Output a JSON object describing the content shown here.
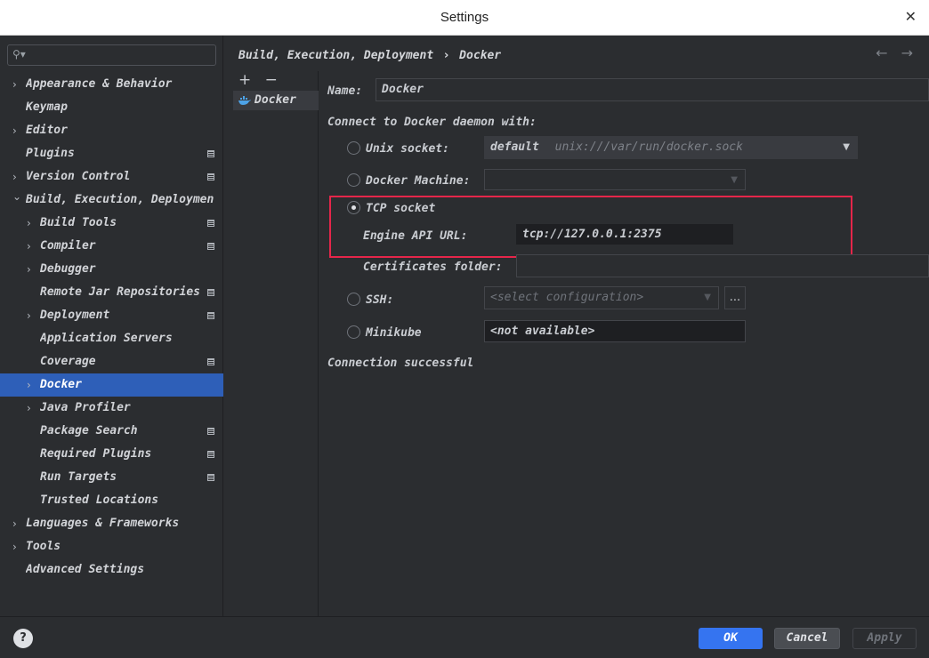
{
  "window": {
    "title": "Settings",
    "close_glyph": "✕"
  },
  "search": {
    "icon": "search-icon",
    "value": ""
  },
  "tree": [
    {
      "label": "Appearance & Behavior",
      "level": 0,
      "expandable": true,
      "expanded": false,
      "marker": false,
      "selected": false
    },
    {
      "label": "Keymap",
      "level": 0,
      "expandable": false,
      "expanded": false,
      "marker": false,
      "selected": false
    },
    {
      "label": "Editor",
      "level": 0,
      "expandable": true,
      "expanded": false,
      "marker": false,
      "selected": false
    },
    {
      "label": "Plugins",
      "level": 0,
      "expandable": false,
      "expanded": false,
      "marker": true,
      "selected": false
    },
    {
      "label": "Version Control",
      "level": 0,
      "expandable": true,
      "expanded": false,
      "marker": true,
      "selected": false
    },
    {
      "label": "Build, Execution, Deployment",
      "level": 0,
      "expandable": true,
      "expanded": true,
      "marker": false,
      "selected": false
    },
    {
      "label": "Build Tools",
      "level": 1,
      "expandable": true,
      "expanded": false,
      "marker": true,
      "selected": false
    },
    {
      "label": "Compiler",
      "level": 1,
      "expandable": true,
      "expanded": false,
      "marker": true,
      "selected": false
    },
    {
      "label": "Debugger",
      "level": 1,
      "expandable": true,
      "expanded": false,
      "marker": false,
      "selected": false
    },
    {
      "label": "Remote Jar Repositories",
      "level": 1,
      "expandable": false,
      "expanded": false,
      "marker": true,
      "selected": false
    },
    {
      "label": "Deployment",
      "level": 1,
      "expandable": true,
      "expanded": false,
      "marker": true,
      "selected": false
    },
    {
      "label": "Application Servers",
      "level": 1,
      "expandable": false,
      "expanded": false,
      "marker": false,
      "selected": false
    },
    {
      "label": "Coverage",
      "level": 1,
      "expandable": false,
      "expanded": false,
      "marker": true,
      "selected": false
    },
    {
      "label": "Docker",
      "level": 1,
      "expandable": true,
      "expanded": false,
      "marker": false,
      "selected": true
    },
    {
      "label": "Java Profiler",
      "level": 1,
      "expandable": true,
      "expanded": false,
      "marker": false,
      "selected": false
    },
    {
      "label": "Package Search",
      "level": 1,
      "expandable": false,
      "expanded": false,
      "marker": true,
      "selected": false
    },
    {
      "label": "Required Plugins",
      "level": 1,
      "expandable": false,
      "expanded": false,
      "marker": true,
      "selected": false
    },
    {
      "label": "Run Targets",
      "level": 1,
      "expandable": false,
      "expanded": false,
      "marker": true,
      "selected": false
    },
    {
      "label": "Trusted Locations",
      "level": 1,
      "expandable": false,
      "expanded": false,
      "marker": false,
      "selected": false
    },
    {
      "label": "Languages & Frameworks",
      "level": 0,
      "expandable": true,
      "expanded": false,
      "marker": false,
      "selected": false
    },
    {
      "label": "Tools",
      "level": 0,
      "expandable": true,
      "expanded": false,
      "marker": false,
      "selected": false
    },
    {
      "label": "Advanced Settings",
      "level": 0,
      "expandable": false,
      "expanded": false,
      "marker": false,
      "selected": false
    }
  ],
  "breadcrumb": {
    "parent": "Build, Execution, Deployment",
    "separator": "›",
    "current": "Docker"
  },
  "nav": {
    "back_glyph": "←",
    "forward_glyph": "→"
  },
  "list": {
    "add_glyph": "+",
    "remove_glyph": "−",
    "items": [
      {
        "label": "Docker",
        "icon": "docker-icon"
      }
    ]
  },
  "form": {
    "name_label": "Name:",
    "name_value": "Docker",
    "connect_label": "Connect to Docker daemon with:",
    "unix": {
      "label": "Unix socket:",
      "value": "default",
      "hint": "unix:///var/run/docker.sock",
      "selected": false
    },
    "machine": {
      "label": "Docker Machine:",
      "value": "",
      "selected": false
    },
    "tcp": {
      "label": "TCP socket",
      "selected": true,
      "engine_label": "Engine API URL:",
      "engine_value": "tcp://127.0.0.1:2375",
      "cert_label": "Certificates folder:",
      "cert_value": ""
    },
    "ssh": {
      "label": "SSH:",
      "value": "<select configuration>",
      "browse": "...",
      "selected": false
    },
    "minikube": {
      "label": "Minikube",
      "value": "<not available>",
      "selected": false
    },
    "status": "Connection successful",
    "highlight_color": "#e5264a"
  },
  "buttons": {
    "help": "?",
    "ok": "OK",
    "cancel": "Cancel",
    "apply": "Apply"
  },
  "colors": {
    "accent": "#3574f0",
    "selection": "#2e5fb8",
    "background": "#2b2d30"
  }
}
